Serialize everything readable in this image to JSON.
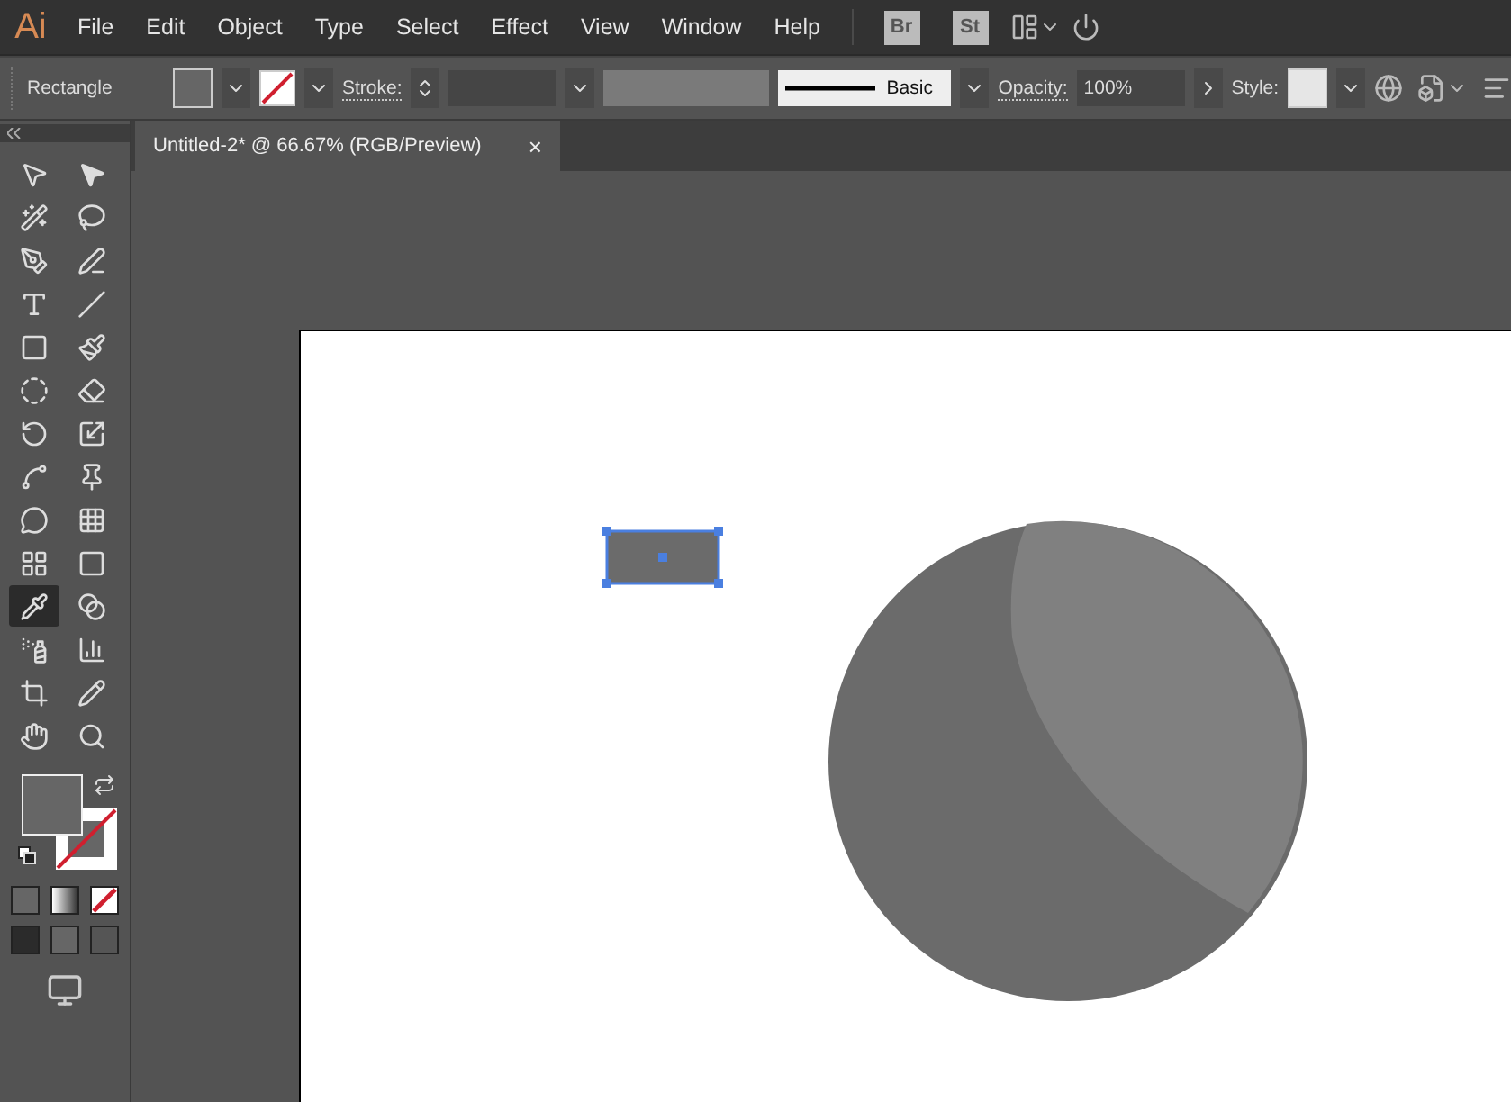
{
  "app": {
    "logo": "Ai"
  },
  "menu": [
    "File",
    "Edit",
    "Object",
    "Type",
    "Select",
    "Effect",
    "View",
    "Window",
    "Help"
  ],
  "bridge_buttons": [
    "Br",
    "St"
  ],
  "control_bar": {
    "selection": "Rectangle",
    "stroke_label": "Stroke:",
    "brush": "Basic",
    "opacity_label": "Opacity:",
    "opacity": "100%",
    "style_label": "Style:"
  },
  "document_tab": {
    "title": "Untitled-2* @ 66.67% (RGB/Preview)",
    "close": "×"
  },
  "tools": [
    {
      "selected": false
    },
    {
      "selected": false
    },
    {
      "selected": false
    },
    {
      "selected": false
    },
    {
      "selected": false
    },
    {
      "selected": false
    },
    {
      "selected": false
    },
    {
      "selected": false
    },
    {
      "selected": false
    },
    {
      "selected": false
    },
    {
      "selected": false
    },
    {
      "selected": false
    },
    {
      "selected": false
    },
    {
      "selected": false
    },
    {
      "selected": false
    },
    {
      "selected": false
    },
    {
      "selected": false
    },
    {
      "selected": false
    },
    {
      "selected": false
    },
    {
      "selected": false
    },
    {
      "selected": true
    },
    {
      "selected": false
    },
    {
      "selected": false
    },
    {
      "selected": false
    },
    {
      "selected": false
    },
    {
      "selected": false
    },
    {
      "selected": false
    },
    {
      "selected": false
    }
  ],
  "canvas": {
    "rectangle_selected": true
  }
}
